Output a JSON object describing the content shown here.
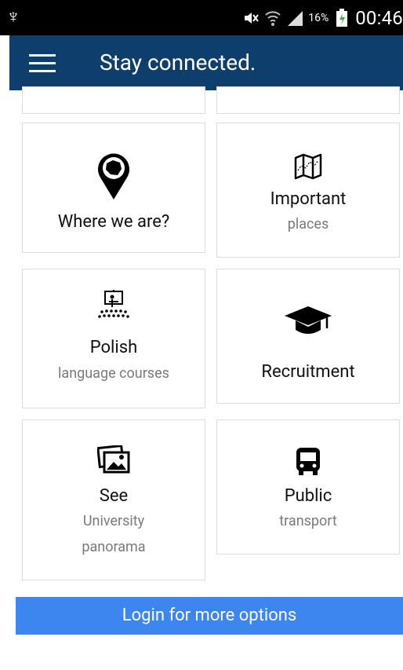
{
  "status_bar": {
    "time": "00:46",
    "battery_percent": "16%",
    "icons": [
      "usb-icon",
      "mute-icon",
      "wifi-icon",
      "signal-icon",
      "battery-icon"
    ]
  },
  "app_bar": {
    "title": "Stay connected.",
    "color": "#0e3f6c"
  },
  "cards": {
    "where_we_are": {
      "title": "Where we are?",
      "icon": "location-pin-icon"
    },
    "important_places": {
      "title": "Important",
      "subtitle": "places",
      "icon": "map-icon"
    },
    "polish_courses": {
      "title": "Polish",
      "subtitle": "language courses",
      "icon": "lecture-icon"
    },
    "recruitment": {
      "title": "Recruitment",
      "icon": "graduation-cap-icon"
    },
    "panorama": {
      "title": "See",
      "subtitle_line1": "University",
      "subtitle_line2": "panorama",
      "icon": "photos-icon"
    },
    "transport": {
      "title": "Public",
      "subtitle": "transport",
      "icon": "bus-icon"
    }
  },
  "login_button": {
    "label": "Login for more options",
    "color": "#3d86ef"
  }
}
